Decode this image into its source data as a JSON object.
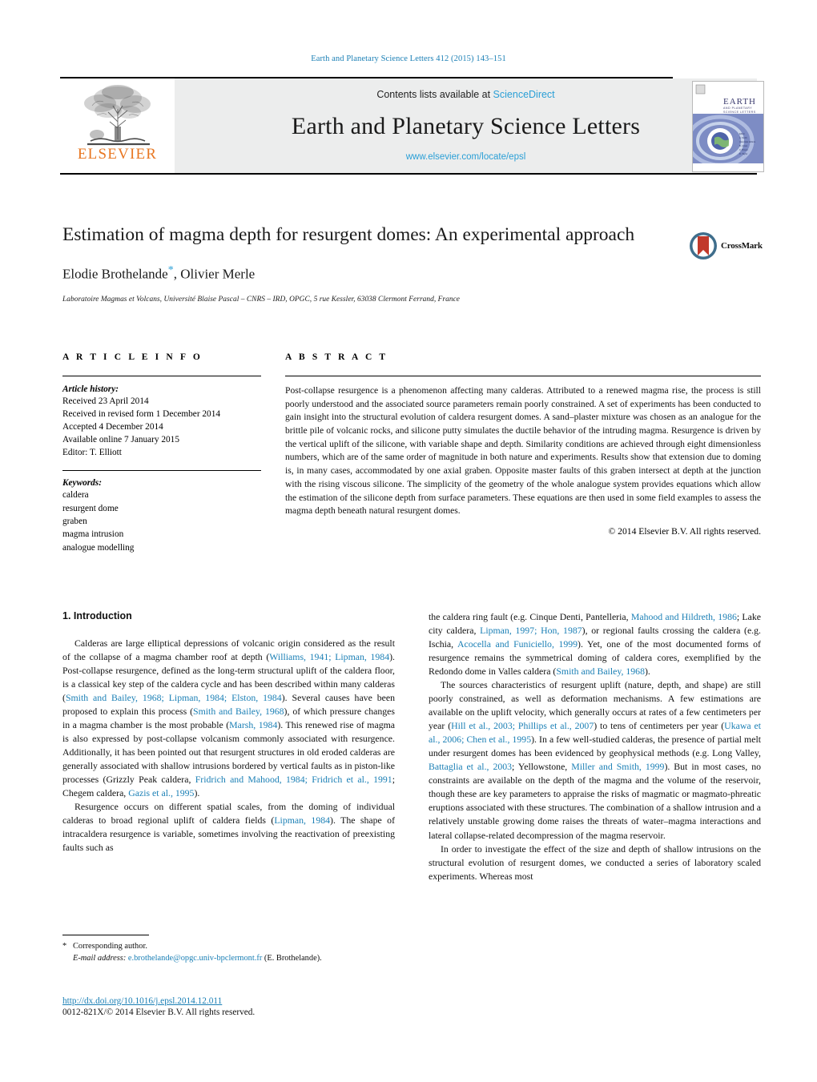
{
  "running_head": "Earth and Planetary Science Letters 412 (2015) 143–151",
  "masthead": {
    "contents_prefix": "Contents lists available at ",
    "sciencedirect": "ScienceDirect",
    "journal_title": "Earth and Planetary Science Letters",
    "journal_url": "www.elsevier.com/locate/epsl",
    "publisher_wordmark": "ELSEVIER",
    "cover_title_line1": "EARTH",
    "cover_title_line2": "AND PLANETARY",
    "cover_title_line3": "SCIENCE LETTERS"
  },
  "article": {
    "title": "Estimation of magma depth for resurgent domes: An experimental approach",
    "authors": "Elodie Brothelande",
    "authors_star": "*",
    "authors_rest": ", Olivier Merle",
    "affiliation": "Laboratoire Magmas et Volcans, Université Blaise Pascal – CNRS – IRD, OPGC, 5 rue Kessler, 63038 Clermont Ferrand, France",
    "crossmark_label": "CrossMark"
  },
  "info": {
    "heading": "A R T I C L E   I N F O",
    "history_label": "Article history:",
    "history": [
      "Received 23 April 2014",
      "Received in revised form 1 December 2014",
      "Accepted 4 December 2014",
      "Available online 7 January 2015",
      "Editor: T. Elliott"
    ],
    "keywords_label": "Keywords:",
    "keywords": [
      "caldera",
      "resurgent dome",
      "graben",
      "magma intrusion",
      "analogue modelling"
    ]
  },
  "abstract": {
    "heading": "A B S T R A C T",
    "text": "Post-collapse resurgence is a phenomenon affecting many calderas. Attributed to a renewed magma rise, the process is still poorly understood and the associated source parameters remain poorly constrained. A set of experiments has been conducted to gain insight into the structural evolution of caldera resurgent domes. A sand–plaster mixture was chosen as an analogue for the brittle pile of volcanic rocks, and silicone putty simulates the ductile behavior of the intruding magma. Resurgence is driven by the vertical uplift of the silicone, with variable shape and depth. Similarity conditions are achieved through eight dimensionless numbers, which are of the same order of magnitude in both nature and experiments. Results show that extension due to doming is, in many cases, accommodated by one axial graben. Opposite master faults of this graben intersect at depth at the junction with the rising viscous silicone. The simplicity of the geometry of the whole analogue system provides equations which allow the estimation of the silicone depth from surface parameters. These equations are then used in some field examples to assess the magma depth beneath natural resurgent domes.",
    "copyright": "© 2014 Elsevier B.V. All rights reserved."
  },
  "body": {
    "section_heading": "1. Introduction",
    "left_col": {
      "p1_a": "Calderas are large elliptical depressions of volcanic origin considered as the result of the collapse of a magma chamber roof at depth (",
      "p1_ref1": "Williams, 1941; Lipman, 1984",
      "p1_b": "). Post-collapse resurgence, defined as the long-term structural uplift of the caldera floor, is a classical key step of the caldera cycle and has been described within many calderas (",
      "p1_ref2": "Smith and Bailey, 1968; Lipman, 1984; Elston, 1984",
      "p1_c": "). Several causes have been proposed to explain this process (",
      "p1_ref3": "Smith and Bailey, 1968",
      "p1_d": "), of which pressure changes in a magma chamber is the most probable (",
      "p1_ref4": "Marsh, 1984",
      "p1_e": "). This renewed rise of magma is also expressed by post-collapse volcanism commonly associated with resurgence. Additionally, it has been pointed out that resurgent structures in old eroded calderas are generally associated with shallow intrusions bordered by vertical faults as in piston-like processes (Grizzly Peak caldera, ",
      "p1_ref5": "Fridrich and Mahood, 1984; Fridrich et al., 1991",
      "p1_f": "; Chegem caldera, ",
      "p1_ref6": "Gazis et al., 1995",
      "p1_g": ").",
      "p2_a": "Resurgence occurs on different spatial scales, from the doming of individual calderas to broad regional uplift of caldera fields (",
      "p2_ref1": "Lipman, 1984",
      "p2_b": "). The shape of intracaldera resurgence is variable, sometimes involving the reactivation of preexisting faults such as"
    },
    "right_col": {
      "p1_a": "the caldera ring fault (e.g. Cinque Denti, Pantelleria, ",
      "p1_ref1": "Mahood and Hildreth, 1986",
      "p1_b": "; Lake city caldera, ",
      "p1_ref2": "Lipman, 1997; Hon, 1987",
      "p1_c": "), or regional faults crossing the caldera (e.g. Ischia, ",
      "p1_ref3": "Acocella and Funiciello, 1999",
      "p1_d": "). Yet, one of the most documented forms of resurgence remains the symmetrical doming of caldera cores, exemplified by the Redondo dome in Valles caldera (",
      "p1_ref4": "Smith and Bailey, 1968",
      "p1_e": ").",
      "p2_a": "The sources characteristics of resurgent uplift (nature, depth, and shape) are still poorly constrained, as well as deformation mechanisms. A few estimations are available on the uplift velocity, which generally occurs at rates of a few centimeters per year (",
      "p2_ref1": "Hill et al., 2003; Phillips et al., 2007",
      "p2_b": ") to tens of centimeters per year (",
      "p2_ref2": "Ukawa et al., 2006; Chen et al., 1995",
      "p2_c": "). In a few well-studied calderas, the presence of partial melt under resurgent domes has been evidenced by geophysical methods (e.g. Long Valley, ",
      "p2_ref3": "Battaglia et al., 2003",
      "p2_d": "; Yellowstone, ",
      "p2_ref4": "Miller and Smith, 1999",
      "p2_e": "). But in most cases, no constraints are available on the depth of the magma and the volume of the reservoir, though these are key parameters to appraise the risks of magmatic or magmato-phreatic eruptions associated with these structures. The combination of a shallow intrusion and a relatively unstable growing dome raises the threats of water–magma interactions and lateral collapse-related decompression of the magma reservoir.",
      "p3": "In order to investigate the effect of the size and depth of shallow intrusions on the structural evolution of resurgent domes, we conducted a series of laboratory scaled experiments. Whereas most"
    }
  },
  "footnote": {
    "star": "*",
    "corresponding": "Corresponding author.",
    "email_label": "E-mail address:",
    "email": "e.brothelande@opgc.univ-bpclermont.fr",
    "email_suffix": "(E. Brothelande)."
  },
  "footer": {
    "doi": "http://dx.doi.org/10.1016/j.epsl.2014.12.011",
    "issn": "0012-821X/© 2014 Elsevier B.V. All rights reserved."
  },
  "colors": {
    "link": "#1a7fb5",
    "sciencedirect": "#2a9fd6",
    "elsevier_orange": "#E87722",
    "masthead_bg": "#eceded"
  }
}
